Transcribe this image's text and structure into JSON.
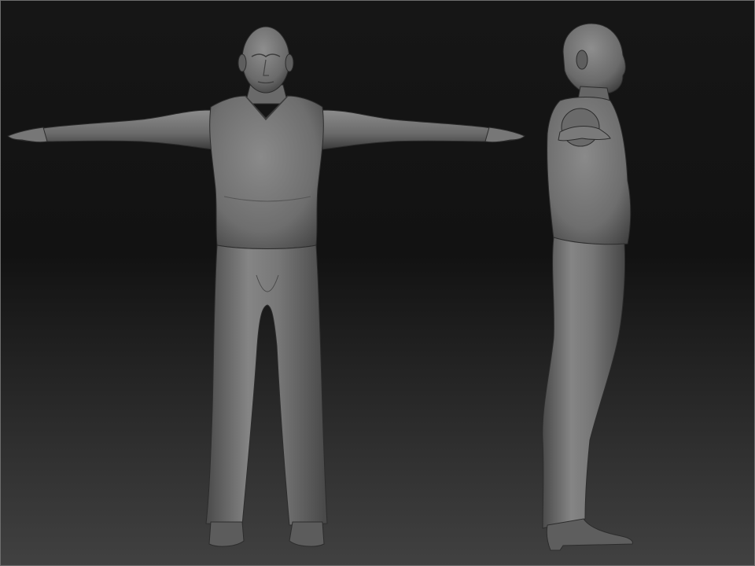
{
  "scene": {
    "views": [
      {
        "view": "front",
        "pose": "t-pose"
      },
      {
        "view": "side",
        "facing": "right"
      }
    ],
    "colors": {
      "background_top": "#141414",
      "background_bottom": "#3e3e3e",
      "border": "#7a7a7a",
      "clay_light": "#8a8a8a",
      "clay_mid": "#6b6b6b",
      "clay_dark": "#3f3f3f",
      "outline": "#2a2a2a"
    }
  }
}
